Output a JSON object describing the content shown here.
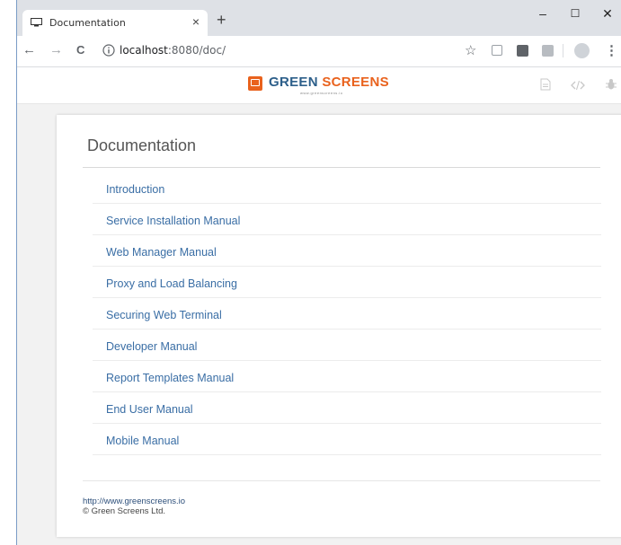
{
  "browser": {
    "tab_title": "Documentation",
    "tab_close": "×",
    "new_tab": "+",
    "window_controls": {
      "minimize": "–",
      "maximize": "☐",
      "close": "✕"
    },
    "nav": {
      "back": "←",
      "forward": "→",
      "reload": "C"
    },
    "address": {
      "host": "localhost",
      "path": ":8080/doc/"
    },
    "bookmark_star": "☆",
    "menu": "⋮",
    "icons": [
      "monitor-icon",
      "info-icon",
      "star-icon",
      "extension-icon",
      "profile-icon"
    ]
  },
  "app_header": {
    "logo_green": "GREEN",
    "logo_screens": "SCREENS",
    "logo_tagline": "www.greenscreens.io",
    "logo_color": "#e9621d",
    "icons": [
      "document-icon",
      "code-icon",
      "bug-icon"
    ]
  },
  "page": {
    "title": "Documentation",
    "items": [
      {
        "label": "Introduction"
      },
      {
        "label": "Service Installation Manual"
      },
      {
        "label": "Web Manager Manual"
      },
      {
        "label": "Proxy and Load Balancing"
      },
      {
        "label": "Securing Web Terminal"
      },
      {
        "label": "Developer Manual"
      },
      {
        "label": "Report Templates Manual"
      },
      {
        "label": "End User Manual"
      },
      {
        "label": "Mobile Manual"
      }
    ],
    "link_color": "#3a6ea5"
  },
  "footer": {
    "url": "http://www.greenscreens.io",
    "copyright": "© Green Screens Ltd."
  }
}
